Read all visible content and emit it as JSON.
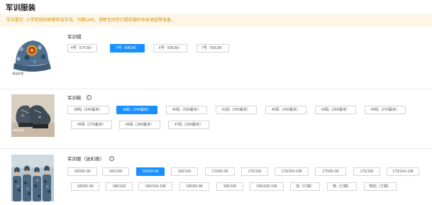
{
  "page": {
    "title": "军训服装",
    "notice": "军训提示: 入学前到后即需参加军训。为期14天。请新生同学们提前做好各体调适等准备。"
  },
  "items": {
    "cap": {
      "title": "军训帽",
      "image_caption": "海迷彩帽",
      "selected": "5号（58CM）",
      "options": [
        "4号（57CM）",
        "5号（58CM）",
        "6号（59CM）",
        "7号（60CM）"
      ]
    },
    "shoes": {
      "title": "军训鞋",
      "image_caption": "海迷彩鞋",
      "selected": "39码（245毫米）",
      "options": [
        "38码（240毫米）",
        "39码（245毫米）",
        "40码（250毫米）",
        "41码（255毫米）",
        "42码（260毫米）",
        "43码（265毫米）",
        "44码（270毫米）",
        "45码（275毫米）",
        "46码（280毫米）",
        "47码（290毫米）"
      ]
    },
    "uniform": {
      "title": "军训服（迷彩服）",
      "selected": "165/92-96",
      "options": [
        "160/92-96",
        "160/100",
        "165/92-96",
        "165/100",
        "170/92-96",
        "170/100",
        "170/104-108",
        "175/92-96",
        "175/100",
        "175/104-108",
        "180/92-96",
        "180/100",
        "180/104-108",
        "185/92-96",
        "185/100",
        "185/100-108",
        "加（订做）",
        "特（订做）",
        "特加（订做）"
      ]
    }
  },
  "colors": {
    "accent": "#1890ff",
    "notice_bg": "#fdf6e7",
    "notice_text": "#d4900a"
  },
  "icons": {
    "info": "info-circle-icon"
  }
}
